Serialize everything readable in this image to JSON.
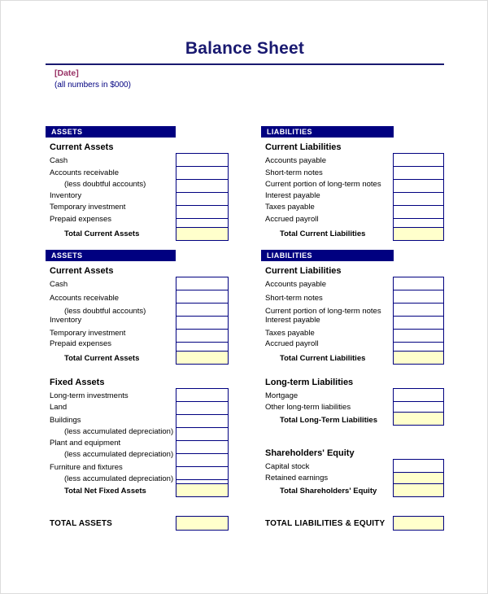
{
  "document": {
    "title": "Balance Sheet",
    "date_placeholder": "[Date]",
    "units_note": "(all numbers in $000)"
  },
  "colors": {
    "navy": "#000080",
    "title_navy": "#191970",
    "date_magenta": "#993366",
    "total_fill": "#ffffcc",
    "page_bg": "#ffffff"
  },
  "sections": {
    "assets_bar_1": "ASSETS",
    "liabilities_bar_1": "LIABILITIES",
    "assets_bar_2": "ASSETS",
    "liabilities_bar_2": "LIABILITIES",
    "current_assets_1": "Current Assets",
    "current_liabilities_1": "Current Liabilities",
    "current_assets_2": "Current Assets",
    "current_liabilities_2": "Current Liabilities",
    "fixed_assets": "Fixed Assets",
    "long_term_liabilities": "Long-term Liabilities",
    "shareholders_equity": "Shareholders' Equity"
  },
  "current_assets_items": [
    {
      "label": "Cash",
      "value": "",
      "filled": false
    },
    {
      "label": "Accounts receivable",
      "value": "",
      "filled": false
    },
    {
      "label": "(less doubtful accounts)",
      "value": "",
      "filled": false
    },
    {
      "label": "Inventory",
      "value": "",
      "filled": false
    },
    {
      "label": "Temporary investment",
      "value": "",
      "filled": false
    },
    {
      "label": "Prepaid expenses",
      "value": "",
      "filled": false
    },
    {
      "label": "Total Current Assets",
      "value": "",
      "filled": true
    }
  ],
  "current_liabilities_items": [
    {
      "label": "Accounts payable",
      "value": "",
      "filled": false
    },
    {
      "label": "Short-term notes",
      "value": "",
      "filled": false
    },
    {
      "label": "Current portion of long-term notes",
      "value": "",
      "filled": false
    },
    {
      "label": "Interest payable",
      "value": "",
      "filled": false
    },
    {
      "label": "Taxes payable",
      "value": "",
      "filled": false
    },
    {
      "label": "Accrued payroll",
      "value": "",
      "filled": false
    },
    {
      "label": "Total Current Liabilities",
      "value": "",
      "filled": true
    }
  ],
  "fixed_assets_items": [
    {
      "label": "Long-term investments",
      "value": "",
      "filled": false
    },
    {
      "label": "Land",
      "value": "",
      "filled": false
    },
    {
      "label": "Buildings",
      "value": "",
      "filled": false
    },
    {
      "label": "(less accumulated depreciation)",
      "value": "",
      "filled": false
    },
    {
      "label": "Plant and equipment",
      "value": "",
      "filled": false
    },
    {
      "label": "(less accumulated depreciation)",
      "value": "",
      "filled": false
    },
    {
      "label": "Furniture and fixtures",
      "value": "",
      "filled": false
    },
    {
      "label": "(less accumulated depreciation)",
      "value": "",
      "filled": false
    },
    {
      "label": "Total Net Fixed Assets",
      "value": "",
      "filled": true
    }
  ],
  "long_term_liabilities_items": [
    {
      "label": "Mortgage",
      "value": "",
      "filled": false
    },
    {
      "label": "Other long-term liabilities",
      "value": "",
      "filled": false
    },
    {
      "label": "Total Long-Term Liabilities",
      "value": "",
      "filled": true
    }
  ],
  "shareholders_equity_items": [
    {
      "label": "Capital stock",
      "value": "",
      "filled": false
    },
    {
      "label": "Retained earnings",
      "value": "",
      "filled": true
    },
    {
      "label": "Total Shareholders' Equity",
      "value": "",
      "filled": true
    }
  ],
  "grand_totals": {
    "total_assets_label": "TOTAL ASSETS",
    "total_assets_value": "",
    "total_liabilities_equity_label": "TOTAL LIABILITIES & EQUITY",
    "total_liabilities_equity_value": ""
  }
}
